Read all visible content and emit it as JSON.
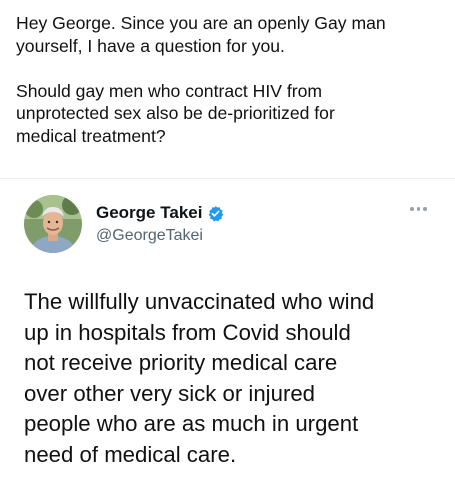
{
  "question": {
    "paragraph_1": "Hey George. Since you are an openly Gay man\nyourself, I have a question for you.",
    "paragraph_2": "Should gay men who contract HIV from\nunprotected sex also be de-prioritized for\nmedical treatment?"
  },
  "tweet": {
    "author_name": "George Takei",
    "author_handle": "@GeorgeTakei",
    "verified_icon": "verified-badge-icon",
    "more_icon": "more-options-icon",
    "body": "The willfully unvaccinated who wind\nup in hospitals from Covid should\nnot receive priority medical care\nover other very sick or injured\npeople who are as much in urgent\nneed of medical care."
  },
  "colors": {
    "text": "#0f1419",
    "handle": "#536471",
    "verified": "#1d9bf0"
  }
}
